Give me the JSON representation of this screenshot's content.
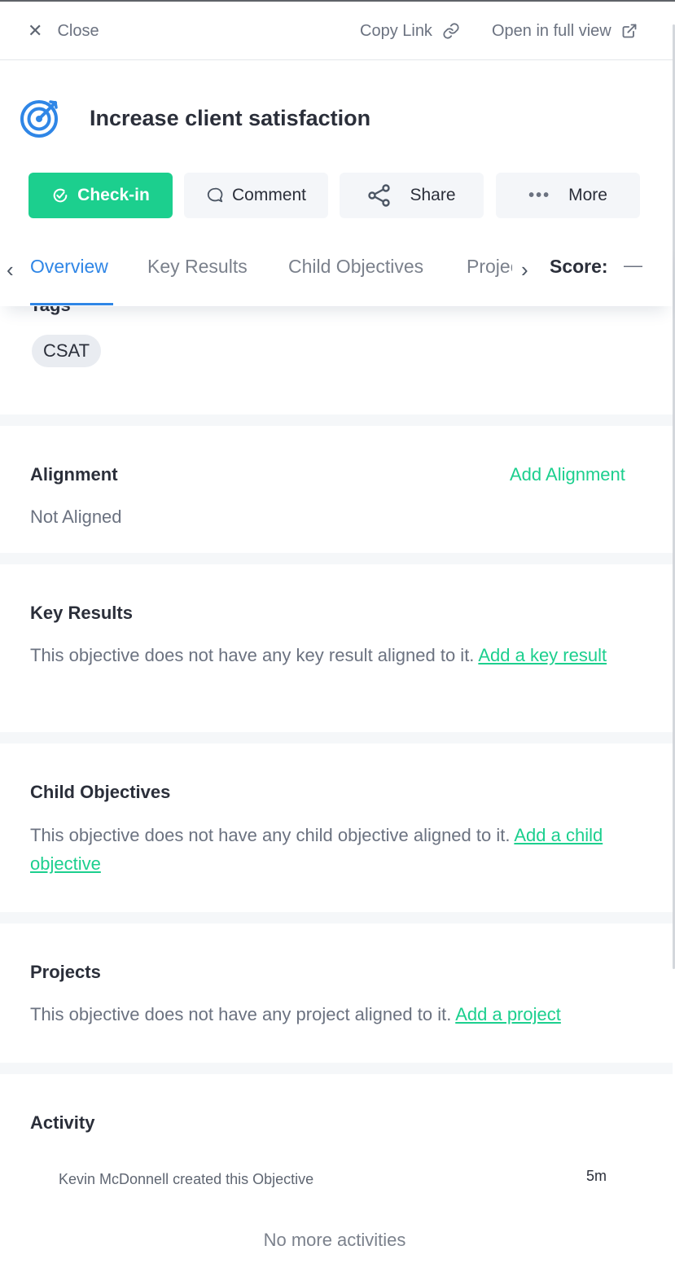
{
  "topbar": {
    "close_label": "Close",
    "copy_link_label": "Copy Link",
    "open_full_label": "Open in full view"
  },
  "objective": {
    "title": "Increase client satisfaction",
    "icon": "target-icon"
  },
  "actions": {
    "checkin": "Check-in",
    "comment": "Comment",
    "share": "Share",
    "more": "More"
  },
  "tabs": {
    "items": [
      "Overview",
      "Key Results",
      "Child Objectives",
      "Projects"
    ],
    "active": "Overview",
    "score_label": "Score:",
    "score_value": "—"
  },
  "tags": {
    "label": "Tags",
    "items": [
      "CSAT"
    ]
  },
  "alignment": {
    "title": "Alignment",
    "action": "Add Alignment",
    "status": "Not Aligned"
  },
  "key_results": {
    "title": "Key Results",
    "text": "This objective does not have any key result aligned to it.",
    "link": "Add a key result"
  },
  "child_objectives": {
    "title": "Child Objectives",
    "text": "This objective does not have any child objective aligned to it.",
    "link": "Add a child objective"
  },
  "projects": {
    "title": "Projects",
    "text": "This objective does not have any project aligned to it.",
    "link": "Add a project"
  },
  "activity": {
    "title": "Activity",
    "entries": [
      {
        "text": "Kevin McDonnell created this Objective",
        "time": "5m"
      }
    ],
    "end_text": "No more activities"
  },
  "colors": {
    "accent_green": "#1ccf8e",
    "tab_blue": "#2f86e6",
    "text_dark": "#2b2f3a",
    "text_muted": "#6b7280"
  }
}
